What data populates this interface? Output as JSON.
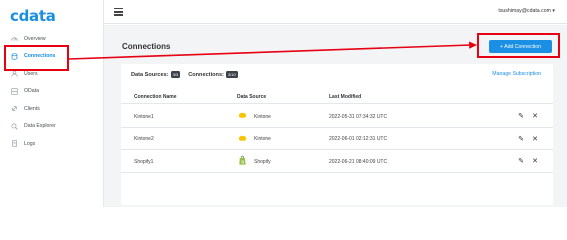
{
  "brand": {
    "logo": "cdata",
    "accent": "#1a8fe3",
    "annotation_color": "#e60012"
  },
  "header": {
    "user_email": "tsushimay@cdata.com"
  },
  "sidebar": {
    "items": [
      {
        "label": "Overview",
        "icon": "overview-icon",
        "active": false
      },
      {
        "label": "Connections",
        "icon": "connections-icon",
        "active": true
      },
      {
        "label": "Users",
        "icon": "users-icon",
        "active": false
      },
      {
        "label": "OData",
        "icon": "odata-icon",
        "active": false
      },
      {
        "label": "Clients",
        "icon": "clients-icon",
        "active": false
      },
      {
        "label": "Data Explorer",
        "icon": "data-explorer-icon",
        "active": false
      },
      {
        "label": "Logs",
        "icon": "logs-icon",
        "active": false
      }
    ]
  },
  "main": {
    "title": "Connections",
    "add_button": "+ Add Connection",
    "data_sources_label": "Data Sources:",
    "data_sources_count": "3/3",
    "connections_label": "Connections:",
    "connections_count": "3/10",
    "manage_link": "Manage Subscription",
    "columns": [
      "Connection Name",
      "Data Source",
      "Last Modified"
    ],
    "rows": [
      {
        "name": "Kintone1",
        "source": "Kintone",
        "source_icon": "kintone-icon",
        "modified": "2022-05-31 07:34:32 UTC"
      },
      {
        "name": "Kintone2",
        "source": "Kintone",
        "source_icon": "kintone-icon",
        "modified": "2022-06-01 02:12:31 UTC"
      },
      {
        "name": "Shopify1",
        "source": "Shopify",
        "source_icon": "shopify-icon",
        "modified": "2022-06-21 08:40:09 UTC"
      }
    ]
  }
}
